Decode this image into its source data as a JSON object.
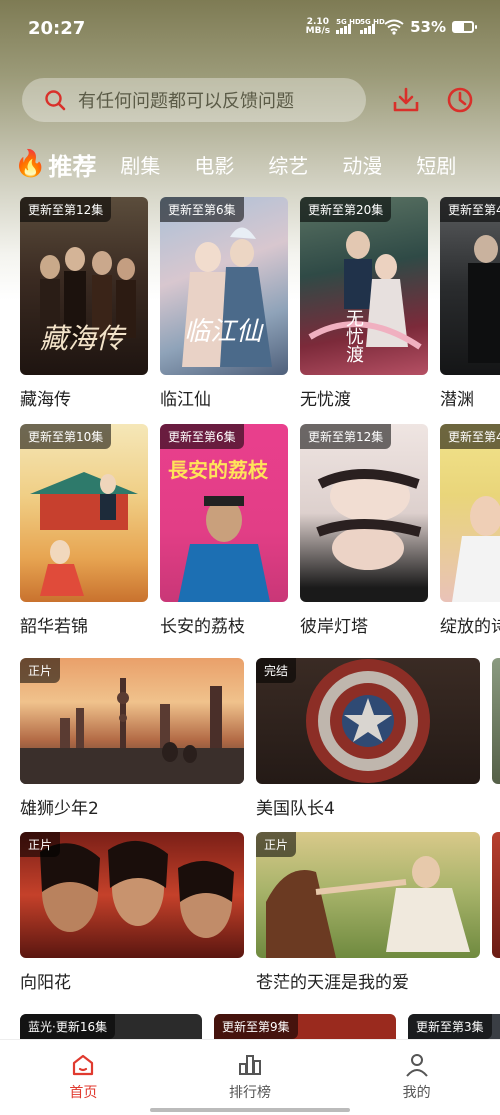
{
  "status": {
    "time": "20:27",
    "net_speed_value": "2.10",
    "net_speed_unit": "MB/s",
    "sim1_label": "5G HD",
    "sim2_label": "5G HD",
    "battery_pct": "53%",
    "battery_level": 0.53
  },
  "search": {
    "placeholder": "有任何问题都可以反馈问题"
  },
  "colors": {
    "accent": "#e03a2f",
    "icon_red": "#d9302a"
  },
  "categories": {
    "active": "推荐",
    "items": [
      "剧集",
      "电影",
      "综艺",
      "动漫",
      "短剧"
    ]
  },
  "row1": [
    {
      "badge": "更新至第12集",
      "title": "藏海传",
      "poster_text": "藏海传"
    },
    {
      "badge": "更新至第6集",
      "title": "临江仙",
      "poster_text": "临江仙"
    },
    {
      "badge": "更新至第20集",
      "title": "无忧渡",
      "poster_text": "无忧渡"
    },
    {
      "badge": "更新至第4",
      "title": "潜渊"
    }
  ],
  "row2": [
    {
      "badge": "更新至第10集",
      "title": "韶华若锦"
    },
    {
      "badge": "更新至第6集",
      "title": "长安的荔枝",
      "poster_text": "長安的荔枝"
    },
    {
      "badge": "更新至第12集",
      "title": "彼岸灯塔"
    },
    {
      "badge": "更新至第4",
      "title": "绽放的诗"
    }
  ],
  "row3": [
    {
      "badge": "正片",
      "title": "雄狮少年2"
    },
    {
      "badge": "完结",
      "title": "美国队长4"
    }
  ],
  "row4": [
    {
      "badge": "正片",
      "title": "向阳花"
    },
    {
      "badge": "正片",
      "title": "苍茫的天涯是我的爱"
    }
  ],
  "row5": [
    {
      "badge": "蓝光·更新16集"
    },
    {
      "badge": "更新至第9集"
    },
    {
      "badge": "更新至第3集"
    }
  ],
  "nav": {
    "home": "首页",
    "ranking": "排行榜",
    "mine": "我的"
  }
}
